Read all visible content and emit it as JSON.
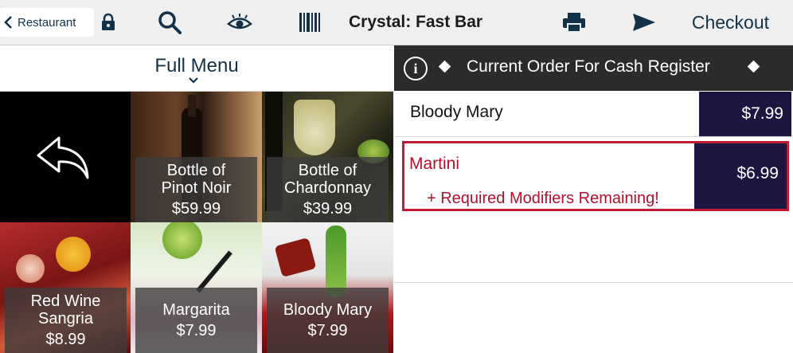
{
  "toolbar": {
    "back_label": "Restaurant",
    "title": "Crystal: Fast Bar",
    "checkout_label": "Checkout",
    "icons": [
      "lock-icon",
      "search-icon",
      "eye-icon",
      "barcode-icon",
      "printer-icon",
      "send-icon"
    ],
    "color": "#12324a"
  },
  "menu": {
    "title": "Full Menu",
    "items": [
      {
        "name_line1": "Bottle of",
        "name_line2": "Pinot Noir",
        "price": "$59.99"
      },
      {
        "name_line1": "Bottle of",
        "name_line2": "Chardonnay",
        "price": "$39.99"
      },
      {
        "name_line1": "Red Wine",
        "name_line2": "Sangria",
        "price": "$8.99"
      },
      {
        "name_line1": "",
        "name_line2": "Margarita",
        "price": "$7.99"
      },
      {
        "name_line1": "",
        "name_line2": "Bloody Mary",
        "price": "$7.99"
      }
    ]
  },
  "order": {
    "title": "Current Order For Cash Register",
    "items": [
      {
        "name": "Bloody Mary",
        "price": "$7.99"
      },
      {
        "name": "Martini",
        "price": "$6.99",
        "notice": "+ Required Modifiers Remaining!"
      }
    ],
    "price_bg": "#1d1640",
    "alert_color": "#c21a32"
  }
}
